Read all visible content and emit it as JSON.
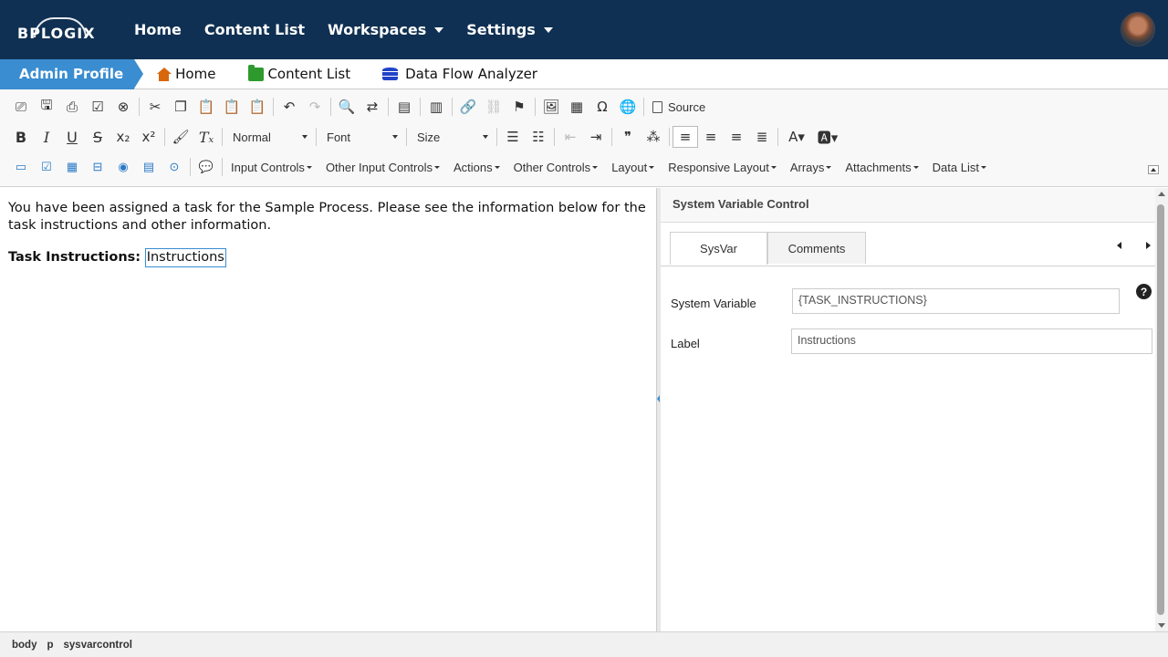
{
  "nav": {
    "logo": "BPLOGIX",
    "links": [
      {
        "label": "Home"
      },
      {
        "label": "Content List"
      },
      {
        "label": "Workspaces"
      },
      {
        "label": "Settings"
      }
    ]
  },
  "breadcrumbs": {
    "active": "Admin Profile",
    "items": [
      {
        "label": "Home",
        "icon": "home-icon"
      },
      {
        "label": "Content List",
        "icon": "folder-icon"
      },
      {
        "label": "Data Flow Analyzer",
        "icon": "database-icon"
      }
    ]
  },
  "toolbar": {
    "source_label": "Source",
    "format_select": "Normal",
    "font_select": "Font",
    "size_select": "Size",
    "menus": [
      "Input Controls",
      "Other Input Controls",
      "Actions",
      "Other Controls",
      "Layout",
      "Responsive Layout",
      "Arrays",
      "Attachments",
      "Data List"
    ]
  },
  "editor": {
    "paragraph": "You have been assigned a task for the Sample Process. Please see the information below for the task instructions and other information.",
    "task_label": "Task Instructions:",
    "sysvar_text": "Instructions"
  },
  "panel": {
    "title": "System Variable Control",
    "tabs": [
      "SysVar",
      "Comments"
    ],
    "fields": {
      "system_variable_label": "System Variable",
      "system_variable_value": "{TASK_INSTRUCTIONS}",
      "label_label": "Label",
      "label_value": "Instructions"
    },
    "help": "?"
  },
  "statusbar": [
    "body",
    "p",
    "sysvarcontrol"
  ],
  "colors": {
    "nav_bg": "#0f3052",
    "accent": "#3a8dd0"
  }
}
